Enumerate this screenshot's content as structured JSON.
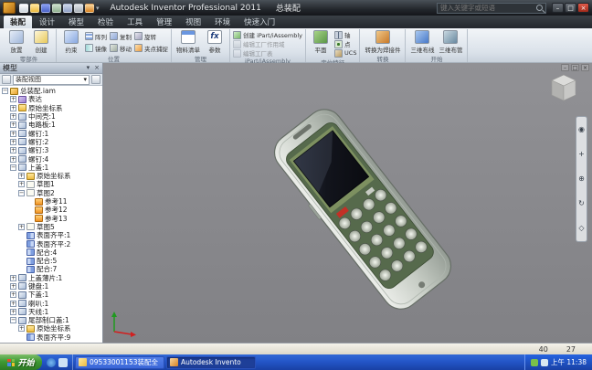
{
  "titlebar": {
    "app_title": "Autodesk Inventor Professional 2011",
    "doc_title": "总装配",
    "search_placeholder": "键入关键字或短语"
  },
  "qat": {
    "icons": [
      {
        "icon": "new-file"
      },
      {
        "icon": "open"
      },
      {
        "icon": "save"
      },
      {
        "icon": "undo"
      },
      {
        "icon": "redo"
      },
      {
        "icon": "print"
      },
      {
        "icon": "update"
      }
    ]
  },
  "ribbon": {
    "tabs": [
      {
        "label": "装配",
        "active": true
      },
      {
        "label": "设计"
      },
      {
        "label": "模型"
      },
      {
        "label": "检验"
      },
      {
        "label": "工具"
      },
      {
        "label": "管理"
      },
      {
        "label": "视图"
      },
      {
        "label": "环境"
      },
      {
        "label": "快速入门"
      }
    ],
    "groups": {
      "component": {
        "label": "零部件",
        "big": [
          {
            "label": "放置",
            "icon": "place"
          },
          {
            "label": "创建",
            "icon": "create"
          }
        ]
      },
      "position": {
        "label": "位置",
        "big": [
          {
            "label": "约束",
            "icon": "constrain"
          }
        ],
        "small": [
          {
            "label": "阵列",
            "icon": "pattern"
          },
          {
            "label": "镜像",
            "icon": "mirror"
          },
          {
            "label": "复制",
            "icon": "copy"
          },
          {
            "label": "移动",
            "icon": "move"
          },
          {
            "label": "旋转",
            "icon": "rotate"
          },
          {
            "label": "夹点捕捉",
            "icon": "grip-snap"
          }
        ]
      },
      "manage": {
        "label": "管理",
        "big": [
          {
            "label": "物料清单",
            "icon": "bom"
          },
          {
            "label": "参数",
            "icon": "fx"
          }
        ]
      },
      "ipart": {
        "label": "iPart/iAssembly",
        "rows": [
          {
            "label": "创建 iPart/iAssembly",
            "icon": "ipart"
          },
          {
            "label": "编辑工厂作用域",
            "icon": "factory-scope",
            "disabled": true
          },
          {
            "label": "编辑工厂表",
            "icon": "factory-table",
            "disabled": true
          }
        ]
      },
      "work_features": {
        "label": "定位特征",
        "big": [
          {
            "label": "平面",
            "icon": "plane"
          }
        ],
        "small": [
          {
            "label": "轴",
            "icon": "axis"
          },
          {
            "label": "点",
            "icon": "point"
          },
          {
            "label": "UCS",
            "icon": "ucs"
          }
        ]
      },
      "convert": {
        "label": "转换",
        "big": [
          {
            "label": "转换为焊接件",
            "icon": "weldment"
          }
        ]
      },
      "begin": {
        "label": "开始",
        "big": [
          {
            "label": "三维布线",
            "icon": "harness"
          },
          {
            "label": "三维布管",
            "icon": "pipe"
          }
        ]
      }
    }
  },
  "browser": {
    "title": "模型",
    "toolbar": {
      "view_label": "装配视图",
      "dd_arrow": "▾"
    },
    "tree": [
      {
        "label": "总装配.iam",
        "depth": 0,
        "icon": "asm-root",
        "exp": "minus"
      },
      {
        "label": "表达",
        "depth": 1,
        "icon": "representations",
        "exp": "plus"
      },
      {
        "label": "原始坐标系",
        "depth": 1,
        "icon": "origin-folder",
        "exp": "plus"
      },
      {
        "label": "中间壳:1",
        "depth": 1,
        "icon": "part",
        "exp": "plus"
      },
      {
        "label": "电路板:1",
        "depth": 1,
        "icon": "part",
        "exp": "plus"
      },
      {
        "label": "螺钉:1",
        "depth": 1,
        "icon": "part",
        "exp": "plus"
      },
      {
        "label": "螺钉:2",
        "depth": 1,
        "icon": "part",
        "exp": "plus"
      },
      {
        "label": "螺钉:3",
        "depth": 1,
        "icon": "part",
        "exp": "plus"
      },
      {
        "label": "螺钉:4",
        "depth": 1,
        "icon": "part",
        "exp": "plus"
      },
      {
        "label": "上盖:1",
        "depth": 1,
        "icon": "part",
        "exp": "minus"
      },
      {
        "label": "原始坐标系",
        "depth": 2,
        "icon": "origin-folder",
        "exp": "plus"
      },
      {
        "label": "草图1",
        "depth": 2,
        "icon": "sketch",
        "exp": "plus"
      },
      {
        "label": "草图2",
        "depth": 2,
        "icon": "sketch",
        "exp": "minus"
      },
      {
        "label": "参考11",
        "depth": 3,
        "icon": "reference"
      },
      {
        "label": "参考12",
        "depth": 3,
        "icon": "reference"
      },
      {
        "label": "参考13",
        "depth": 3,
        "icon": "reference"
      },
      {
        "label": "草图5",
        "depth": 2,
        "icon": "sketch",
        "exp": "plus"
      },
      {
        "label": "表面齐平:1",
        "depth": 2,
        "icon": "flush"
      },
      {
        "label": "表面齐平:2",
        "depth": 2,
        "icon": "flush"
      },
      {
        "label": "配合:4",
        "depth": 2,
        "icon": "mate"
      },
      {
        "label": "配合:5",
        "depth": 2,
        "icon": "mate"
      },
      {
        "label": "配合:7",
        "depth": 2,
        "icon": "mate"
      },
      {
        "label": "上盖薄片:1",
        "depth": 1,
        "icon": "part",
        "exp": "plus"
      },
      {
        "label": "键盘:1",
        "depth": 1,
        "icon": "part",
        "exp": "plus"
      },
      {
        "label": "下盖:1",
        "depth": 1,
        "icon": "part",
        "exp": "plus"
      },
      {
        "label": "喇叭:1",
        "depth": 1,
        "icon": "part",
        "exp": "plus"
      },
      {
        "label": "天线:1",
        "depth": 1,
        "icon": "part",
        "exp": "plus"
      },
      {
        "label": "尾部制口盖:1",
        "depth": 1,
        "icon": "part",
        "exp": "minus"
      },
      {
        "label": "原始坐标系",
        "depth": 2,
        "icon": "origin-folder",
        "exp": "plus"
      },
      {
        "label": "表面齐平:9",
        "depth": 2,
        "icon": "flush"
      }
    ]
  },
  "viewport": {
    "navbar": [
      {
        "icon": "nav-wheel"
      },
      {
        "icon": "nav-pan"
      },
      {
        "icon": "nav-zoom"
      },
      {
        "icon": "nav-orbit"
      },
      {
        "icon": "nav-look"
      }
    ]
  },
  "statusbar": {
    "hint": "",
    "counters": [
      "40",
      "27"
    ]
  },
  "taskbar": {
    "start_label": "开始",
    "quick_launch": [
      {
        "icon": "ie"
      },
      {
        "icon": "show-desktop"
      }
    ],
    "tasks": [
      {
        "label": "09533001153装配全",
        "icon": "explorer-folder",
        "active": false
      },
      {
        "label": "Autodesk Invento",
        "icon": "inventor-app",
        "active": true
      }
    ],
    "tray_time": "上午 11:38"
  }
}
